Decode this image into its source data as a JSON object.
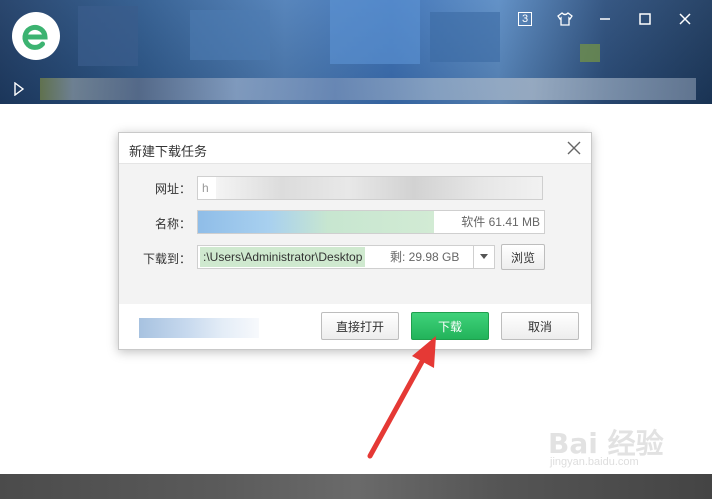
{
  "header": {
    "logo_icon": "ie-style-e-logo",
    "tab_count": "3",
    "controls": [
      "tab-count",
      "skin-shirt-icon",
      "minimize-icon",
      "maximize-icon",
      "close-icon"
    ]
  },
  "dialog": {
    "title": "新建下载任务",
    "url_label": "网址：",
    "url_value": "h",
    "name_label": "名称：",
    "name_size": "软件 61.41 MB",
    "saveto_label": "下载到：",
    "saveto_path": ":\\Users\\Administrator\\Desktop",
    "saveto_free": "剩: 29.98 GB",
    "browse_label": "浏览",
    "open_direct_label": "直接打开",
    "download_label": "下载",
    "cancel_label": "取消"
  },
  "watermark": {
    "text": "Bai 经验",
    "sub": "jingyan.baidu.com"
  },
  "colors": {
    "accent_green": "#22b35a",
    "arrow_red": "#e53935"
  }
}
